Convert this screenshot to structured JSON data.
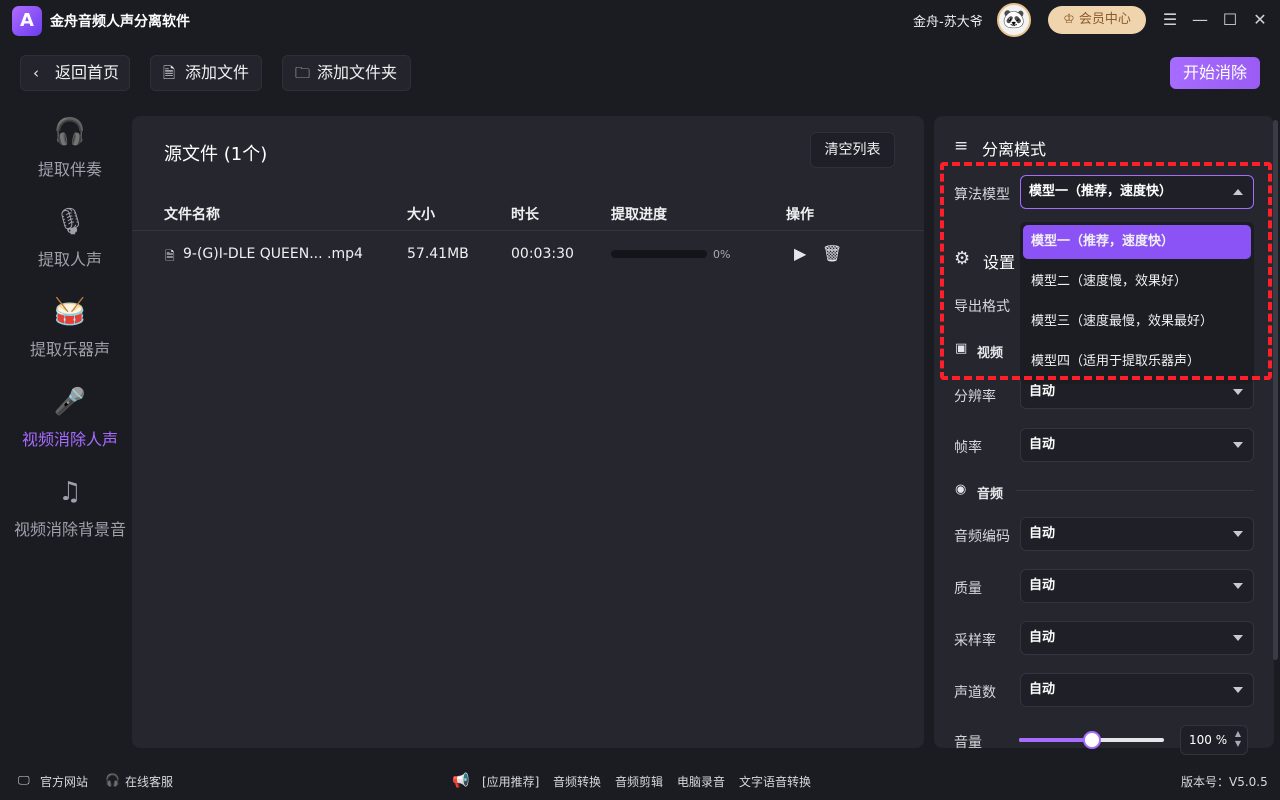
{
  "titlebar": {
    "logo": "A",
    "app_title": "金舟音频人声分离软件",
    "user_name": "金舟-苏大爷",
    "vip_label": "会员中心",
    "icons": [
      "menu-icon",
      "minimize-icon",
      "maximize-icon",
      "close-icon"
    ]
  },
  "toolbar": {
    "back_label": "返回首页",
    "add_file_label": "添加文件",
    "add_folder_label": "添加文件夹",
    "start_label": "开始消除"
  },
  "sidebar": {
    "items": [
      {
        "label": "提取伴奏",
        "icon": "headphones-icon",
        "active": false
      },
      {
        "label": "提取人声",
        "icon": "vocal-headphones-icon",
        "active": false
      },
      {
        "label": "提取乐器声",
        "icon": "drum-icon",
        "active": false
      },
      {
        "label": "视频消除人声",
        "icon": "mic-off-icon",
        "active": true
      },
      {
        "label": "视频消除背景音",
        "icon": "music-off-icon",
        "active": false
      }
    ]
  },
  "main": {
    "title": "源文件 (1个)",
    "clear_label": "清空列表",
    "columns": [
      "文件名称",
      "大小",
      "时长",
      "提取进度",
      "操作"
    ],
    "rows": [
      {
        "name": "9-(G)I-DLE QUEEN...  .mp4",
        "size": "57.41MB",
        "duration": "00:03:30",
        "progress": 0,
        "progress_label": "0%"
      }
    ]
  },
  "settings": {
    "mode_title": "分离模式",
    "algo_label": "算法模型",
    "algo_value": "模型一（推荐，速度快）",
    "algo_options": [
      "模型一（推荐，速度快）",
      "模型二（速度慢，效果好）",
      "模型三（速度最慢，效果最好）",
      "模型四（适用于提取乐器声）"
    ],
    "settings_title": "设置",
    "export_label": "导出格式",
    "video_title": "视频",
    "resolution_label": "分辨率",
    "resolution_value": "自动",
    "framerate_label": "帧率",
    "framerate_value": "自动",
    "audio_title": "音频",
    "codec_label": "音频编码",
    "codec_value": "自动",
    "quality_label": "质量",
    "quality_value": "自动",
    "samplerate_label": "采样率",
    "samplerate_value": "自动",
    "channels_label": "声道数",
    "channels_value": "自动",
    "volume_label": "音量",
    "volume_value": "100 %",
    "volume_level": 0.5
  },
  "footer": {
    "site_label": "官方网站",
    "service_label": "在线客服",
    "recommend_label": "[应用推荐]",
    "links": [
      "音频转换",
      "音频剪辑",
      "电脑录音",
      "文字语音转换"
    ],
    "version": "版本号：V5.0.5"
  }
}
